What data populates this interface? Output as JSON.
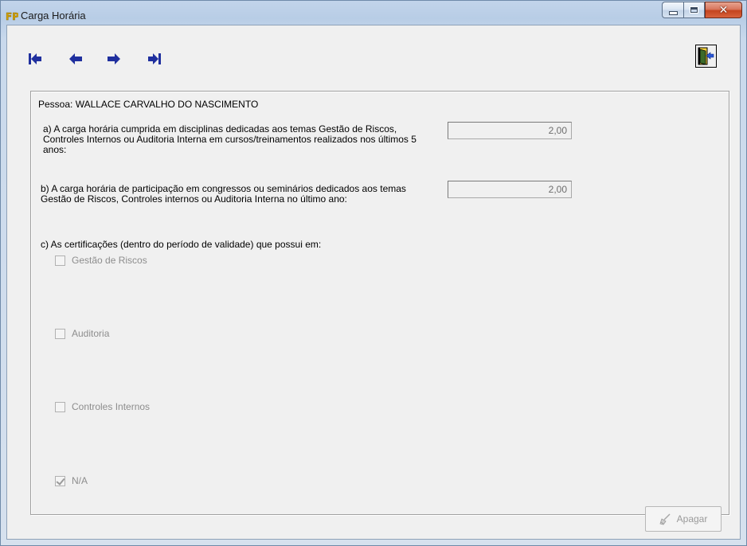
{
  "window": {
    "title": "Carga Horária"
  },
  "toolbar": {
    "nav": [
      {
        "name": "first-record",
        "icon": "first-arrow-icon"
      },
      {
        "name": "previous-record",
        "icon": "left-arrow-icon"
      },
      {
        "name": "next-record",
        "icon": "right-arrow-icon"
      },
      {
        "name": "last-record",
        "icon": "last-arrow-icon"
      }
    ],
    "exit_icon": "exit-door-icon"
  },
  "form": {
    "person_label": "Pessoa: WALLACE CARVALHO DO NASCIMENTO",
    "question_a": "a)  A carga horária cumprida em disciplinas dedicadas aos temas Gestão de Riscos, Controles Internos ou Auditoria Interna em cursos/treinamentos realizados nos últimos 5 anos:",
    "value_a": "2,00",
    "question_b": "b) A carga horária de participação em congressos ou seminários dedicados aos temas Gestão de Riscos, Controles internos ou Auditoria Interna no último ano:",
    "value_b": "2,00",
    "question_c": "c) As certificações (dentro do período de validade) que possui em:",
    "certifications": [
      {
        "label": "Gestão de Riscos",
        "checked": false
      },
      {
        "label": "Auditoria",
        "checked": false
      },
      {
        "label": "Controles Internos",
        "checked": false
      },
      {
        "label": "N/A",
        "checked": true
      }
    ]
  },
  "actions": {
    "delete_label": "Apagar"
  },
  "colors": {
    "nav_arrow": "#1f2f9e",
    "disabled_text": "#8d8d8d"
  }
}
